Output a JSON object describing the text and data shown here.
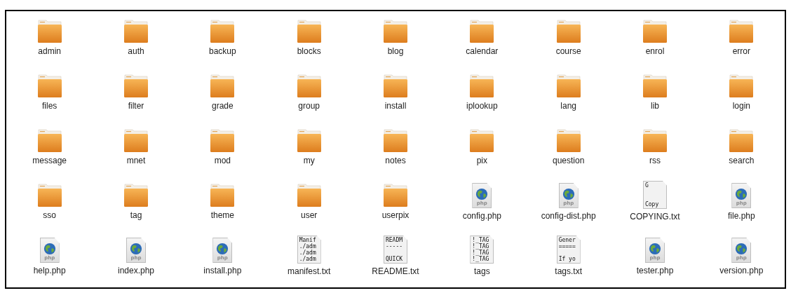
{
  "items": [
    {
      "name": "admin",
      "kind": "folder"
    },
    {
      "name": "auth",
      "kind": "folder"
    },
    {
      "name": "backup",
      "kind": "folder"
    },
    {
      "name": "blocks",
      "kind": "folder"
    },
    {
      "name": "blog",
      "kind": "folder"
    },
    {
      "name": "calendar",
      "kind": "folder"
    },
    {
      "name": "course",
      "kind": "folder"
    },
    {
      "name": "enrol",
      "kind": "folder"
    },
    {
      "name": "error",
      "kind": "folder"
    },
    {
      "name": "files",
      "kind": "folder"
    },
    {
      "name": "filter",
      "kind": "folder"
    },
    {
      "name": "grade",
      "kind": "folder"
    },
    {
      "name": "group",
      "kind": "folder"
    },
    {
      "name": "install",
      "kind": "folder"
    },
    {
      "name": "iplookup",
      "kind": "folder"
    },
    {
      "name": "lang",
      "kind": "folder"
    },
    {
      "name": "lib",
      "kind": "folder"
    },
    {
      "name": "login",
      "kind": "folder"
    },
    {
      "name": "message",
      "kind": "folder"
    },
    {
      "name": "mnet",
      "kind": "folder"
    },
    {
      "name": "mod",
      "kind": "folder"
    },
    {
      "name": "my",
      "kind": "folder"
    },
    {
      "name": "notes",
      "kind": "folder"
    },
    {
      "name": "pix",
      "kind": "folder"
    },
    {
      "name": "question",
      "kind": "folder"
    },
    {
      "name": "rss",
      "kind": "folder"
    },
    {
      "name": "search",
      "kind": "folder"
    },
    {
      "name": "sso",
      "kind": "folder"
    },
    {
      "name": "tag",
      "kind": "folder"
    },
    {
      "name": "theme",
      "kind": "folder"
    },
    {
      "name": "user",
      "kind": "folder"
    },
    {
      "name": "userpix",
      "kind": "folder"
    },
    {
      "name": "config.php",
      "kind": "php",
      "badge": "php"
    },
    {
      "name": "config-dist.php",
      "kind": "php",
      "badge": "php"
    },
    {
      "name": "COPYING.txt",
      "kind": "text",
      "preview_top": [
        "G"
      ],
      "preview_bottom": [
        "Copy"
      ]
    },
    {
      "name": "file.php",
      "kind": "php",
      "badge": "php"
    },
    {
      "name": "help.php",
      "kind": "php",
      "badge": "php"
    },
    {
      "name": "index.php",
      "kind": "php",
      "badge": "php"
    },
    {
      "name": "install.php",
      "kind": "php",
      "badge": "php"
    },
    {
      "name": "manifest.txt",
      "kind": "text",
      "preview_top": [
        "Manif",
        "./adm",
        "./adm",
        "./adm"
      ]
    },
    {
      "name": "README.txt",
      "kind": "text",
      "preview_top": [
        "READM",
        "-----"
      ],
      "preview_bottom": [
        "QUICK"
      ]
    },
    {
      "name": "tags",
      "kind": "text",
      "preview_top": [
        "!_TAG",
        "!_TAG",
        "!_TAG",
        "!_TAG"
      ]
    },
    {
      "name": "tags.txt",
      "kind": "text",
      "preview_top": [
        "Gener",
        "====="
      ],
      "preview_bottom": [
        "If yo"
      ]
    },
    {
      "name": "tester.php",
      "kind": "php",
      "badge": "php"
    },
    {
      "name": "version.php",
      "kind": "php",
      "badge": "php"
    }
  ]
}
